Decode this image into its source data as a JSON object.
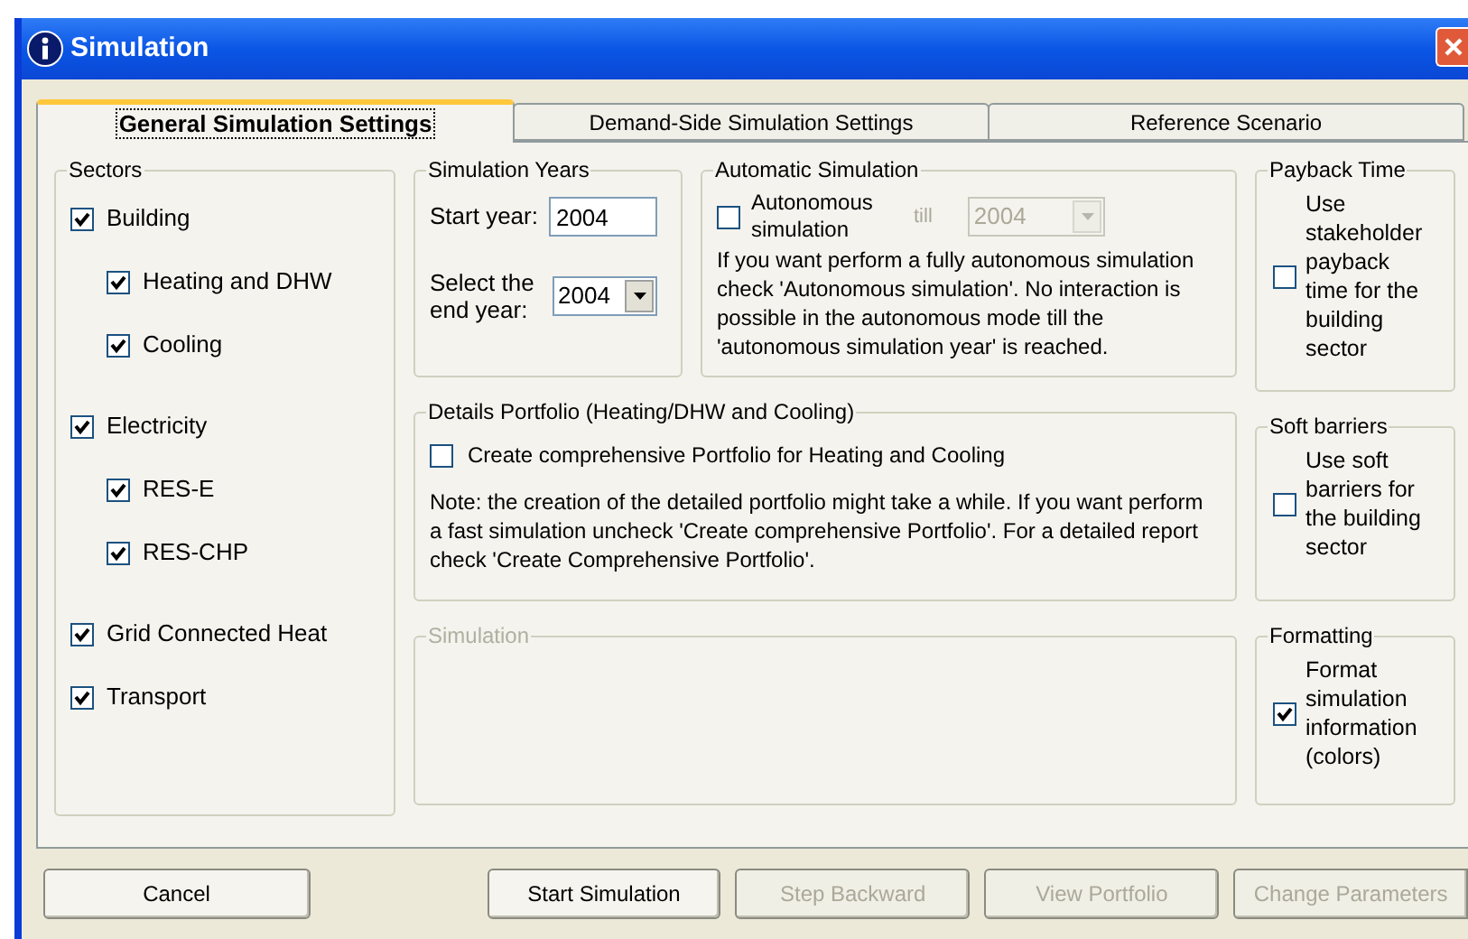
{
  "window": {
    "title": "Simulation"
  },
  "tabs": [
    {
      "label": "General Simulation Settings",
      "selected": true
    },
    {
      "label": "Demand-Side Simulation Settings",
      "selected": false
    },
    {
      "label": "Reference Scenario",
      "selected": false
    }
  ],
  "sectors": {
    "title": "Sectors",
    "items": [
      {
        "label": "Building",
        "checked": true,
        "children": [
          {
            "label": "Heating and DHW",
            "checked": true
          },
          {
            "label": "Cooling",
            "checked": true
          }
        ]
      },
      {
        "label": "Electricity",
        "checked": true,
        "children": [
          {
            "label": "RES-E",
            "checked": true
          },
          {
            "label": "RES-CHP",
            "checked": true
          }
        ]
      },
      {
        "label": "Grid Connected Heat",
        "checked": true
      },
      {
        "label": "Transport",
        "checked": true
      }
    ]
  },
  "simulation_years": {
    "title": "Simulation Years",
    "start_year": {
      "label": "Start year:",
      "value": "2004"
    },
    "end_year": {
      "label": "Select the end year:",
      "value": "2004"
    }
  },
  "automatic_simulation": {
    "title": "Automatic Simulation",
    "checkbox": {
      "label": "Autonomous simulation",
      "checked": false
    },
    "till_label": "till",
    "year_select": {
      "value": "2004",
      "disabled": true
    },
    "description": "If you want perform a fully autonomous simulation check 'Autonomous simulation'.  No interaction is possible in the autonomous mode till the 'autonomous simulation year' is reached."
  },
  "payback_time": {
    "title": "Payback Time",
    "checkbox": {
      "label": "Use stakeholder payback time for the building sector",
      "checked": false
    }
  },
  "details_portfolio": {
    "title": "Details Portfolio (Heating/DHW and Cooling)",
    "checkbox": {
      "label": "Create comprehensive Portfolio for Heating and Cooling",
      "checked": false
    },
    "note": "Note: the creation of the detailed portfolio might take a while. If you want perform a fast simulation uncheck 'Create comprehensive Portfolio'.  For a detailed report check 'Create Comprehensive Portfolio'."
  },
  "soft_barriers": {
    "title": "Soft barriers",
    "checkbox": {
      "label": "Use soft barriers for the building sector",
      "checked": false
    }
  },
  "simulation_panel": {
    "title": "Simulation",
    "disabled": true
  },
  "formatting": {
    "title": "Formatting",
    "checkbox": {
      "label": "Format simulation information (colors)",
      "checked": true
    }
  },
  "buttons": [
    {
      "label": "Cancel",
      "disabled": false
    },
    {
      "label": "Start Simulation",
      "disabled": false
    },
    {
      "label": "Step Backward",
      "disabled": true
    },
    {
      "label": "View Portfolio",
      "disabled": true
    },
    {
      "label": "Change Parameters",
      "disabled": true
    }
  ]
}
